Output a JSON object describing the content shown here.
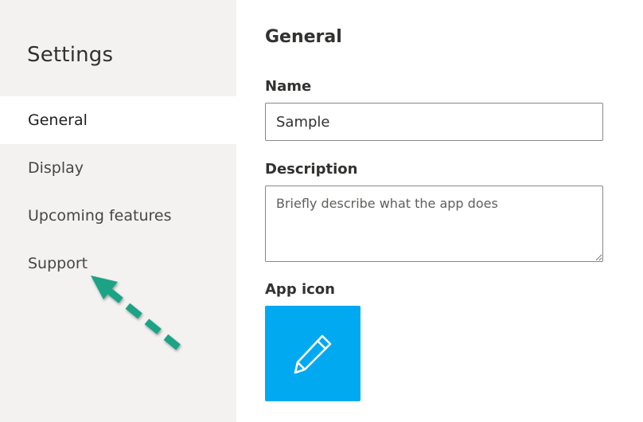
{
  "sidebar": {
    "title": "Settings",
    "items": [
      {
        "label": "General",
        "selected": true
      },
      {
        "label": "Display",
        "selected": false
      },
      {
        "label": "Upcoming features",
        "selected": false
      },
      {
        "label": "Support",
        "selected": false
      }
    ]
  },
  "main": {
    "title": "General",
    "name_label": "Name",
    "name_value": "Sample",
    "description_label": "Description",
    "description_placeholder": "Briefly describe what the app does",
    "description_value": "",
    "app_icon_label": "App icon",
    "app_icon": {
      "icon": "pencil-icon",
      "background_color": "#00a9f0"
    }
  },
  "annotation": {
    "icon": "dashed-arrow",
    "color": "#1fa385"
  }
}
